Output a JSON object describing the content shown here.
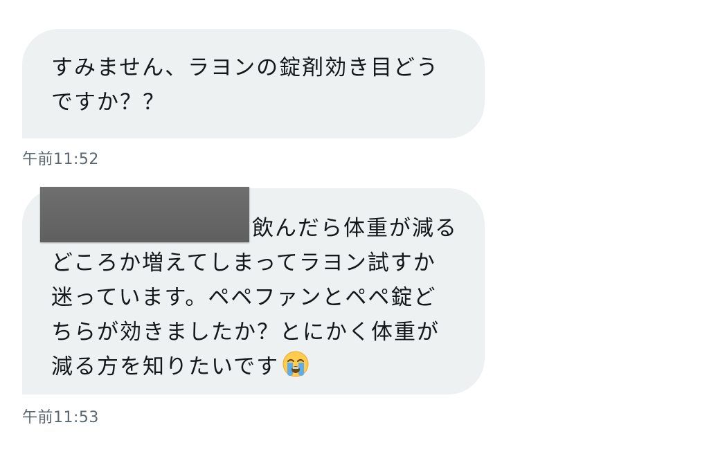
{
  "messages": [
    {
      "lines": [
        "すみません、ラヨンの錠剤効き目どう",
        "ですか？？"
      ],
      "timestamp": "午前11:52"
    },
    {
      "lines": [
        "飲んだら体重が減る",
        "どころか増えてしまってラヨン試すか",
        "迷っています。ペペファンとペペ錠ど",
        "ちらが効きましたか？とにかく体重が",
        "減る方を知りたいです"
      ],
      "emoji": "loudly-crying-face",
      "timestamp": "午前11:53"
    }
  ],
  "colors": {
    "bubble": "#edf1f2",
    "text": "#14171a",
    "timestamp": "#5b6670",
    "redaction": "#666666"
  }
}
